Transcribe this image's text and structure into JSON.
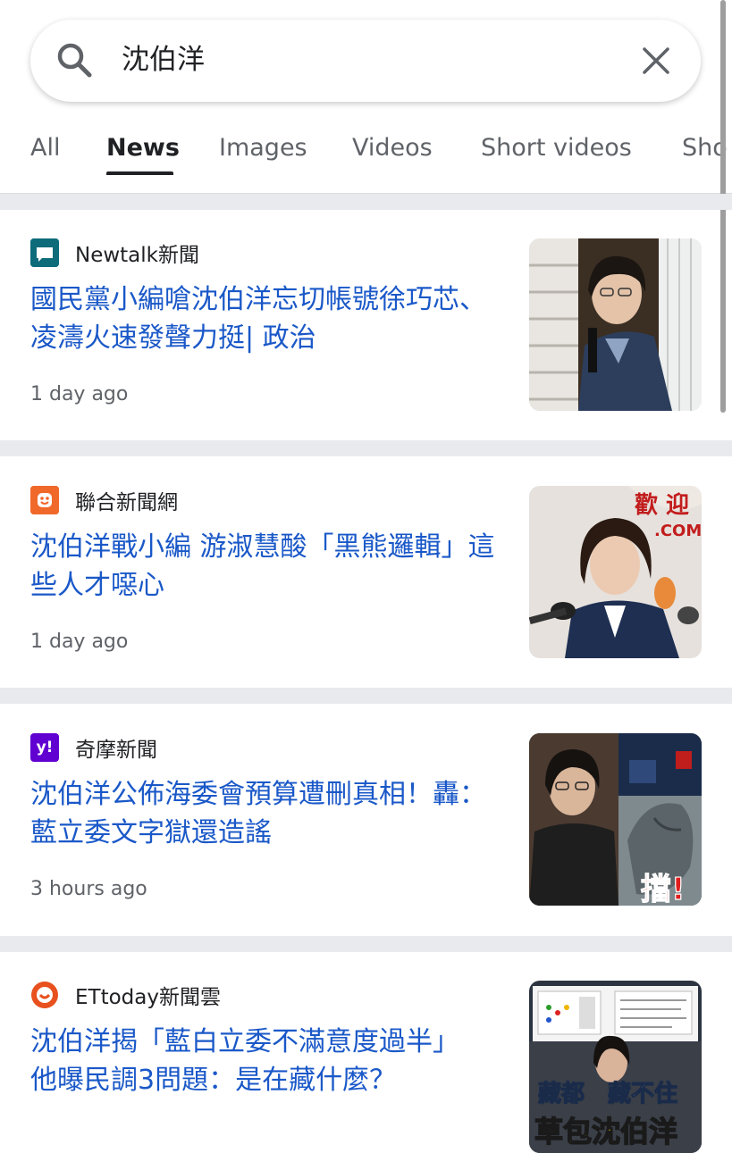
{
  "search": {
    "query": "沈伯洋"
  },
  "tabs": [
    {
      "label": "All"
    },
    {
      "label": "News"
    },
    {
      "label": "Images"
    },
    {
      "label": "Videos"
    },
    {
      "label": "Short videos"
    },
    {
      "label": "Sho"
    }
  ],
  "articles": [
    {
      "source": "Newtalk新聞",
      "title": "國民黨小編嗆沈伯洋忘切帳號徐巧芯、凌濤火速發聲力挺| 政治",
      "time": "1 day ago"
    },
    {
      "source": "聯合新聞網",
      "title": "沈伯洋戰小編 游淑慧酸「黑熊邏輯」這些人才噁心",
      "time": "1 day ago",
      "thumb_text_1": "歡 迎",
      "thumb_text_2": ".COM"
    },
    {
      "source": "奇摩新聞",
      "source_logo_text": "y!",
      "title": "沈伯洋公佈海委會預算遭刪真相！轟：藍立委文字獄還造謠",
      "time": "3 hours ago",
      "thumb_text": "擋!"
    },
    {
      "source": "ETtoday新聞雲",
      "title": "沈伯洋揭「藍白立委不滿意度過半」　他曝民調3問題：是在藏什麼？",
      "thumb_text_1": "藏都　藏不住",
      "thumb_text_2": "草包沈伯洋"
    }
  ],
  "colors": {
    "headline": "#1a58c8",
    "newtalk": "#0e6b7a",
    "udn": "#f0682a",
    "yahoo": "#6001d2",
    "ettoday": "#e8501e"
  }
}
